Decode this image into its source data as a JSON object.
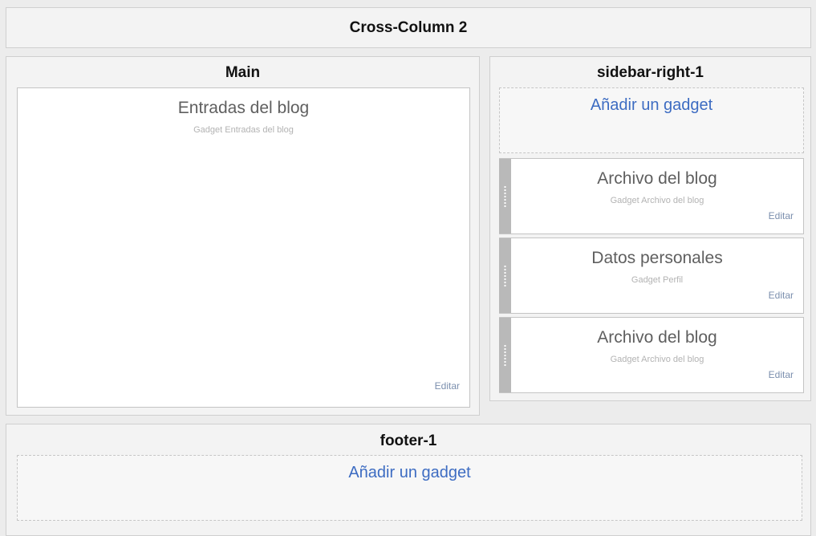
{
  "cross_column": {
    "title": "Cross-Column 2"
  },
  "main": {
    "title": "Main",
    "gadget": {
      "title": "Entradas del blog",
      "subtitle": "Gadget Entradas del blog",
      "edit_label": "Editar"
    }
  },
  "sidebar": {
    "title": "sidebar-right-1",
    "add_gadget_label": "Añadir un gadget",
    "gadgets": [
      {
        "title": "Archivo del blog",
        "subtitle": "Gadget Archivo del blog",
        "edit_label": "Editar"
      },
      {
        "title": "Datos personales",
        "subtitle": "Gadget Perfil",
        "edit_label": "Editar"
      },
      {
        "title": "Archivo del blog",
        "subtitle": "Gadget Archivo del blog",
        "edit_label": "Editar"
      }
    ]
  },
  "footer": {
    "title": "footer-1",
    "add_gadget_label": "Añadir un gadget"
  }
}
